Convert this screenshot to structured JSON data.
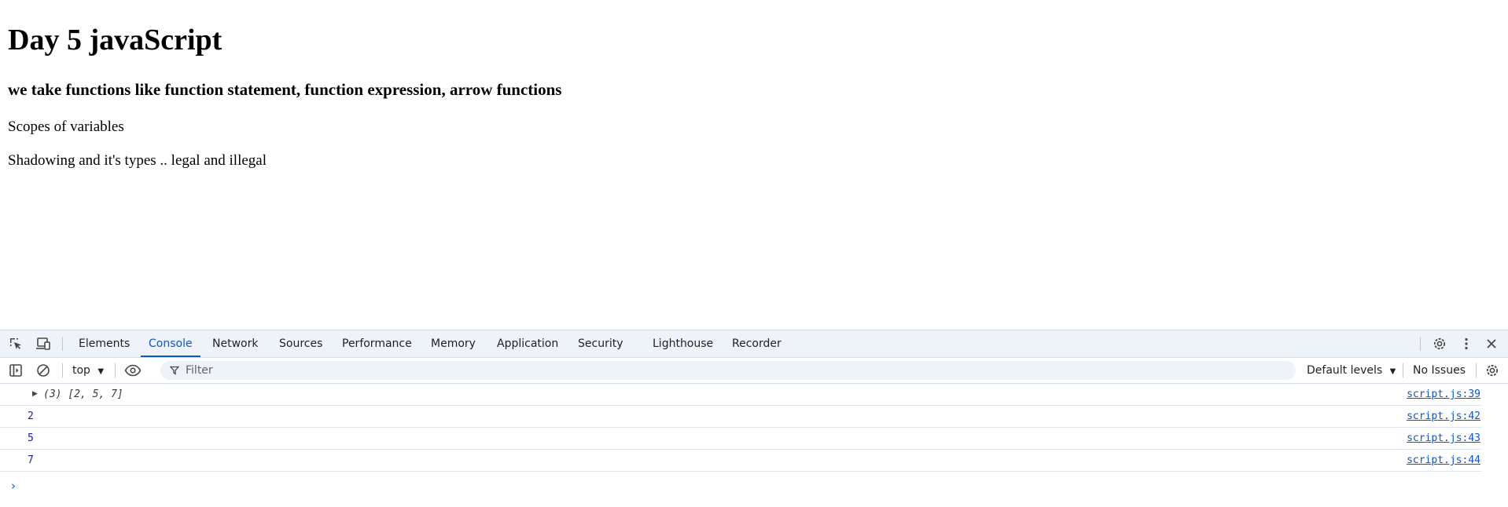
{
  "page": {
    "heading": "Day 5 javaScript",
    "subheading": "we take functions like function statement, function expression, arrow functions",
    "paragraphs": [
      "Scopes of variables",
      "Shadowing and it's types .. legal and illegal"
    ]
  },
  "devtools": {
    "tabs": [
      {
        "label": "Elements"
      },
      {
        "label": "Console",
        "active": true
      },
      {
        "label": "Network"
      },
      {
        "label": "Sources"
      },
      {
        "label": "Performance"
      },
      {
        "label": "Memory"
      },
      {
        "label": "Application"
      },
      {
        "label": "Security"
      },
      {
        "label": "Lighthouse"
      },
      {
        "label": "Recorder"
      }
    ],
    "toolbar": {
      "context": "top",
      "filter_placeholder": "Filter",
      "levels": "Default levels",
      "issues": "No Issues"
    },
    "console": {
      "entries": [
        {
          "count": "(3)",
          "value": "[2, 5, 7]",
          "source": "script.js:39"
        },
        {
          "value": "2",
          "source": "script.js:42"
        },
        {
          "value": "5",
          "source": "script.js:43"
        },
        {
          "value": "7",
          "source": "script.js:44"
        }
      ]
    },
    "accent_color": "#0b57d0"
  }
}
